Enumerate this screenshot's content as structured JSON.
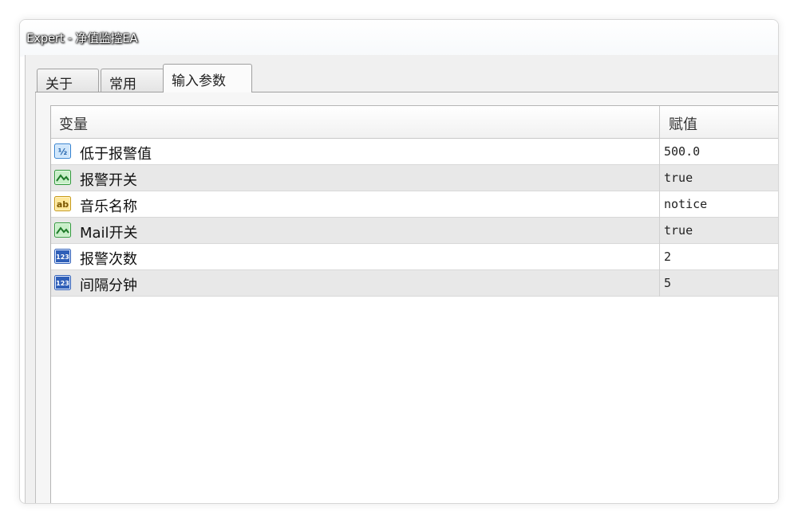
{
  "window": {
    "title": "Expert - 净值监控EA"
  },
  "tabs": [
    {
      "label": "关于",
      "active": false
    },
    {
      "label": "常用",
      "active": false
    },
    {
      "label": "输入参数",
      "active": true
    }
  ],
  "grid": {
    "headers": {
      "variable": "变量",
      "value": "赋值"
    },
    "rows": [
      {
        "icon": "double-value-icon",
        "icon_text": "½",
        "name": "低于报警值",
        "value": "500.0"
      },
      {
        "icon": "bool-icon",
        "icon_text": "",
        "name": "报警开关",
        "value": "true"
      },
      {
        "icon": "string-icon",
        "icon_text": "ab",
        "name": "音乐名称",
        "value": "notice"
      },
      {
        "icon": "bool-icon",
        "icon_text": "",
        "name": "Mail开关",
        "value": "true"
      },
      {
        "icon": "integer-icon",
        "icon_text": "123",
        "name": "报警次数",
        "value": "2"
      },
      {
        "icon": "integer-icon",
        "icon_text": "123",
        "name": "间隔分钟",
        "value": "5"
      }
    ]
  }
}
